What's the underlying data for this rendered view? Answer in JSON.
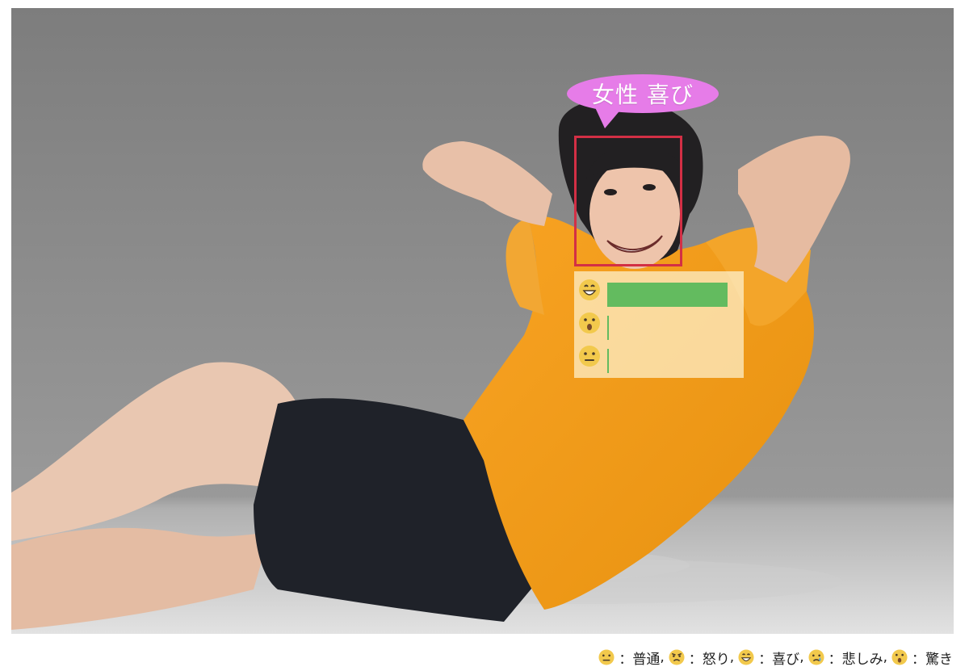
{
  "overlay": {
    "bubble_label": "女性 喜び",
    "bubble_color": "#e67ce8",
    "face_box_color": "#d32f45",
    "bar_color": "#63bb5f"
  },
  "emotion_bars": [
    {
      "emotion": "joy",
      "icon": "grinning-face-icon",
      "level": 1.0
    },
    {
      "emotion": "surprise",
      "icon": "surprised-face-icon",
      "level": 0.01
    },
    {
      "emotion": "neutral",
      "icon": "neutral-face-icon",
      "level": 0.01
    }
  ],
  "legend": {
    "items": [
      {
        "icon": "neutral-face-icon",
        "label": "：普通"
      },
      {
        "icon": "angry-face-icon",
        "label": "：怒り"
      },
      {
        "icon": "grinning-face-icon",
        "label": "：喜び"
      },
      {
        "icon": "crying-face-icon",
        "label": "：悲しみ"
      },
      {
        "icon": "surprised-face-icon",
        "label": "：驚き"
      }
    ],
    "separator": ","
  }
}
